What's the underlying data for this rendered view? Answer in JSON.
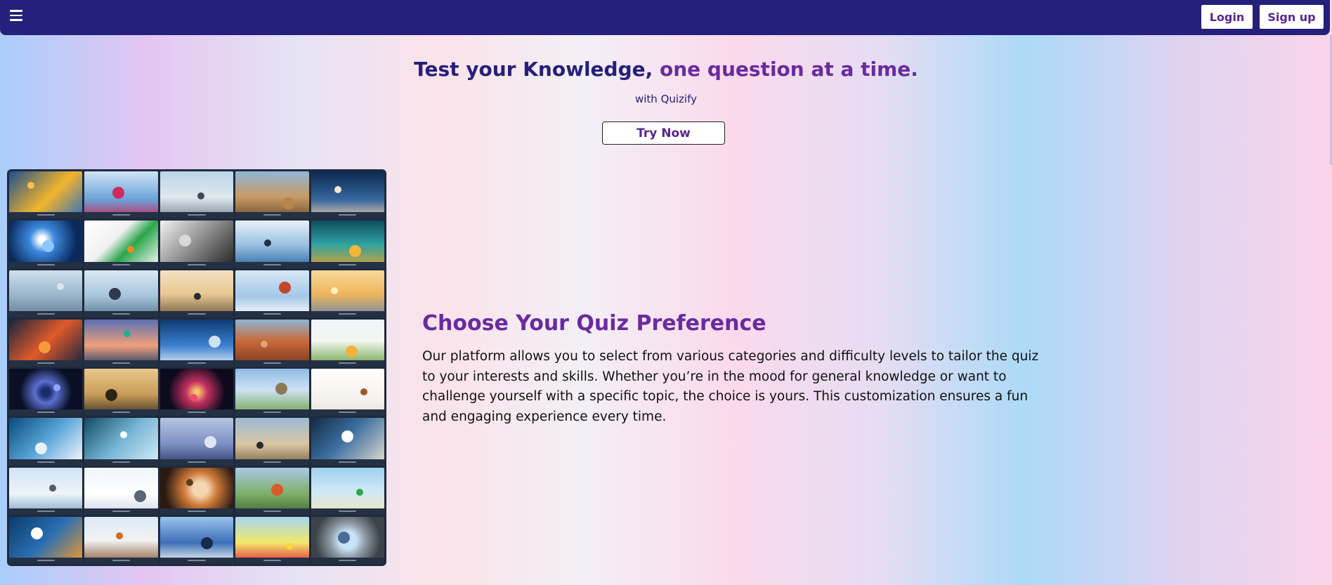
{
  "nav": {
    "menu_icon": "hamburger-menu-icon",
    "login_label": "Login",
    "signup_label": "Sign up"
  },
  "hero": {
    "title_part1": "Test your Knowledge, ",
    "title_part2": "one question at a time.",
    "subtitle": "with Quizify",
    "cta_label": "Try Now"
  },
  "feature": {
    "heading": "Choose Your Quiz Preference",
    "body": "Our platform allows you to select from various categories and difficulty levels to tailor the quiz to your interests and skills. Whether you’re in the mood for general knowledge or want to challenge yourself with a specific topic, the choice is yours. This customization ensures a fun and engaging experience every time."
  },
  "colors": {
    "navbar": "#25207b",
    "accent_purple": "#6a2aa0",
    "title_navy": "#25207b",
    "button_text": "#5a2592"
  },
  "mosaic": {
    "tiles": [
      {
        "bg": "linear-gradient(135deg,#1d4f8f,#f3b52b 55%,#2e6cc5)",
        "dot": "#f6c24a"
      },
      {
        "bg": "linear-gradient(180deg,#cfe3f6,#6aa3d8 60%,#c8295a)",
        "dot": "#d12a5e"
      },
      {
        "bg": "linear-gradient(180deg,#b9d5e8,#dfe8ef 55%,#7d8a93)",
        "dot": "#3e4a52"
      },
      {
        "bg": "linear-gradient(180deg,#8fb6d9,#c99a62 55%,#6e5131)",
        "dot": "#b78650"
      },
      {
        "bg": "linear-gradient(180deg,#0c2850,#36679f 60%,#e7c9a3)",
        "dot": "#f4e7cf"
      },
      {
        "bg": "radial-gradient(circle at 45% 40%,#ffffff 6%,#3c8be0 25%,#0a2a5d 70%)",
        "dot": "#8cc6ff"
      },
      {
        "bg": "linear-gradient(135deg,#ffffff,#f1f1f1 40%,#2aa54a 60%,#ffffff)",
        "dot": "#f08a1e"
      },
      {
        "bg": "linear-gradient(135deg,#f3f3f3,#8b8b8b 50%,#202020)",
        "dot": "#d9d9d9"
      },
      {
        "bg": "linear-gradient(180deg,#e8f1f9,#9cc1e2 50%,#2f6aa7)",
        "dot": "#20324a"
      },
      {
        "bg": "linear-gradient(180deg,#0e4d5c,#2fa3a1 50%,#e1a02e)",
        "dot": "#f2b53a"
      },
      {
        "bg": "linear-gradient(180deg,#cfe1ef,#98b3ca 55%,#5f7d96)",
        "dot": "#d9e6f0"
      },
      {
        "bg": "linear-gradient(180deg,#dbe8f3,#a7c4dd 55%,#5a7890)",
        "dot": "#2d3a4a"
      },
      {
        "bg": "linear-gradient(180deg,#f4e2c2,#e8c894 50%,#6e5a3e)",
        "dot": "#2b2b2b"
      },
      {
        "bg": "linear-gradient(180deg,#d8e8f6,#a5c7e7 55%,#ffffff)",
        "dot": "#c2452a"
      },
      {
        "bg": "linear-gradient(180deg,#f7d99a,#f0b55c 50%,#6f8ba6)",
        "dot": "#fff2c2"
      },
      {
        "bg": "linear-gradient(135deg,#14243c,#e05a2a 50%,#14243c)",
        "dot": "#f59a3c"
      },
      {
        "bg": "linear-gradient(180deg,#5a6fb3,#f0a07a 55%,#1d3a6e)",
        "dot": "#21b08f"
      },
      {
        "bg": "linear-gradient(180deg,#0d3b73,#3c7fd0 55%,#e6f0fa)",
        "dot": "#cfe2f5"
      },
      {
        "bg": "linear-gradient(180deg,#8fb4d6,#c96a3a 45%,#7a3420)",
        "dot": "#e0a27a"
      },
      {
        "bg": "linear-gradient(180deg,#eef4f8,#f4f6f2 45%,#6aa344)",
        "dot": "#f0b23c"
      },
      {
        "bg": "radial-gradient(circle at 50% 50%,#1c2d6e 10%,#5a6fd0 25%,#0a0f25 60%)",
        "dot": "#8ea6ff"
      },
      {
        "bg": "linear-gradient(180deg,#e9c88a,#c99b58 55%,#3b3326)",
        "dot": "#2b2418"
      },
      {
        "bg": "radial-gradient(circle at 50% 50%,#f7c46a 5%,#c2305f 25%,#0d0a1e 65%)",
        "dot": "#f24a6a"
      },
      {
        "bg": "linear-gradient(180deg,#8fbbe6,#cfe2f2 45%,#6ba34a)",
        "dot": "#8c7a56"
      },
      {
        "bg": "linear-gradient(180deg,#ffffff,#f6f2ee 60%,#e8e2dc)",
        "dot": "#a4542a"
      },
      {
        "bg": "linear-gradient(135deg,#0a4a7c,#5aa5d9 50%,#ffffff)",
        "dot": "#e6f2fb"
      },
      {
        "bg": "linear-gradient(135deg,#0f4b63,#77b6d6 50%,#d9eef8)",
        "dot": "#ffffff"
      },
      {
        "bg": "linear-gradient(180deg,#b8c6e2,#7d8fc2 55%,#2f3b6a)",
        "dot": "#dfe6f5"
      },
      {
        "bg": "linear-gradient(180deg,#9bb9d6,#d9c7a2 55%,#7a6346)",
        "dot": "#2a2a2a"
      },
      {
        "bg": "linear-gradient(135deg,#112a44,#3c6fa0 45%,#e8dfd0)",
        "dot": "#ffffff"
      },
      {
        "bg": "linear-gradient(180deg,#cfe3f5,#eef4f9 55%,#7fa6c7)",
        "dot": "#5c5c5c"
      },
      {
        "bg": "linear-gradient(180deg,#eff5fa,#ffffff 55%,#cfd9e2)",
        "dot": "#5a6472"
      },
      {
        "bg": "radial-gradient(circle at 55% 45%,#f4d6b0 15%,#d07a3a 35%,#2a1a12 75%)",
        "dot": "#5a3a22"
      },
      {
        "bg": "linear-gradient(180deg,#a9c9e6,#7fb06a 55%,#3f6a2c)",
        "dot": "#d95a2a"
      },
      {
        "bg": "linear-gradient(180deg,#9fd0ef,#cfe9f5 50%,#f2e2bf)",
        "dot": "#2aa84a"
      },
      {
        "bg": "linear-gradient(135deg,#0b3b6a,#2a6fb3 50%,#f59a2a)",
        "dot": "#ffffff"
      },
      {
        "bg": "linear-gradient(180deg,#dceaf6,#f2f2f2 50%,#8a5a3a)",
        "dot": "#d46a2a"
      },
      {
        "bg": "linear-gradient(180deg,#9ac3ee,#3c6fb6 55%,#ffffff)",
        "dot": "#1a2a4a"
      },
      {
        "bg": "linear-gradient(180deg,#a8d6f2,#f3e76a 55%,#e02a3a)",
        "dot": "#f5d83a"
      },
      {
        "bg": "radial-gradient(circle at 50% 50%,#c8e2f6 20%,#8f9aa4 40%,#3d434a 75%)",
        "dot": "#4a6a9a"
      }
    ]
  }
}
